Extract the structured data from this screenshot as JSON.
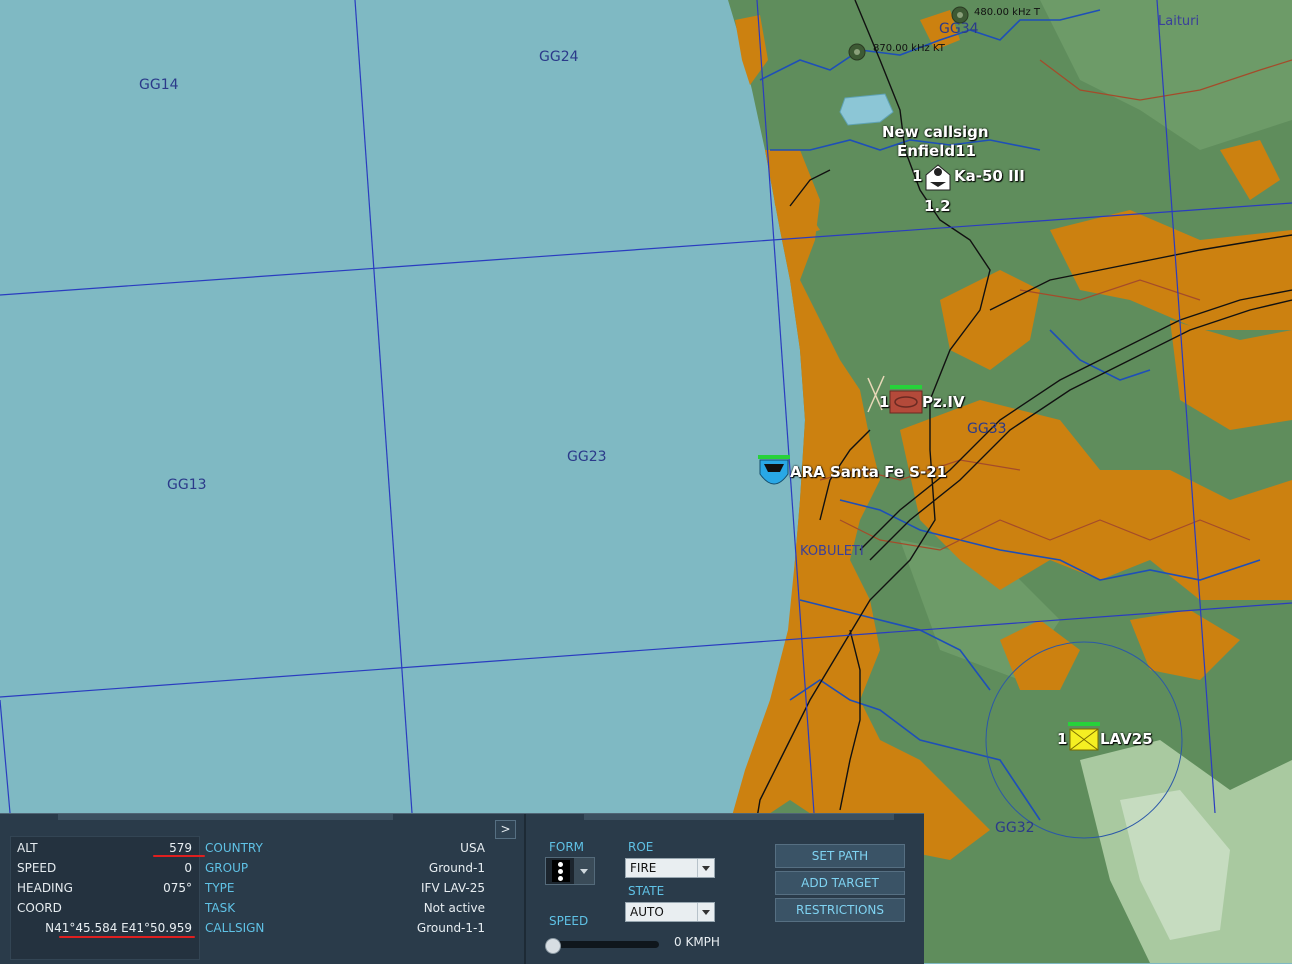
{
  "map": {
    "grid_labels": [
      "GG14",
      "GG24",
      "GG34",
      "GG13",
      "GG23",
      "GG33",
      "GG32"
    ],
    "towns": [
      "Laituri",
      "KOBULETI"
    ],
    "beacons": [
      "480.00 kHz T",
      "870.00 kHz KT"
    ],
    "units": {
      "helo": {
        "group_title": "New callsign",
        "callsign": "Enfield11",
        "count": "1",
        "type": "Ka-50 III",
        "sub": "1.2"
      },
      "tank": {
        "count": "1",
        "type": "Pz.IV"
      },
      "sub": {
        "type": "ARA Santa Fe S-21"
      },
      "lav": {
        "count": "1",
        "type": "LAV25"
      }
    },
    "colors": {
      "sea": "#7fb9c3",
      "land_green": "#5e8d5b",
      "land_orange": "#cc8110",
      "grid_line": "#2a3cc0",
      "river": "#1e4fb8",
      "road": "#111111",
      "border": "#a44b2a"
    }
  },
  "panel": {
    "toggle_label": ">",
    "info": {
      "alt_label": "ALT",
      "alt_value": "579",
      "speed_label": "SPEED",
      "speed_value": "0",
      "heading_label": "HEADING",
      "heading_value": "075°",
      "coord_label": "COORD",
      "coord_value": "N41°45.584 E41°50.959",
      "country_label": "COUNTRY",
      "country_value": "USA",
      "group_label": "GROUP",
      "group_value": "Ground-1",
      "type_label": "TYPE",
      "type_value": "IFV LAV-25",
      "task_label": "TASK",
      "task_value": "Not active",
      "callsign_label": "CALLSIGN",
      "callsign_value": "Ground-1-1"
    },
    "form_label": "FORM",
    "roe_label": "ROE",
    "roe_value": "FIRE",
    "state_label": "STATE",
    "state_value": "AUTO",
    "speed_label": "SPEED",
    "speed_value": "0 KMPH",
    "speed_slider_fraction": 0.0,
    "buttons": {
      "set_path": "SET PATH",
      "add_target": "ADD TARGET",
      "restrictions": "RESTRICTIONS"
    }
  }
}
